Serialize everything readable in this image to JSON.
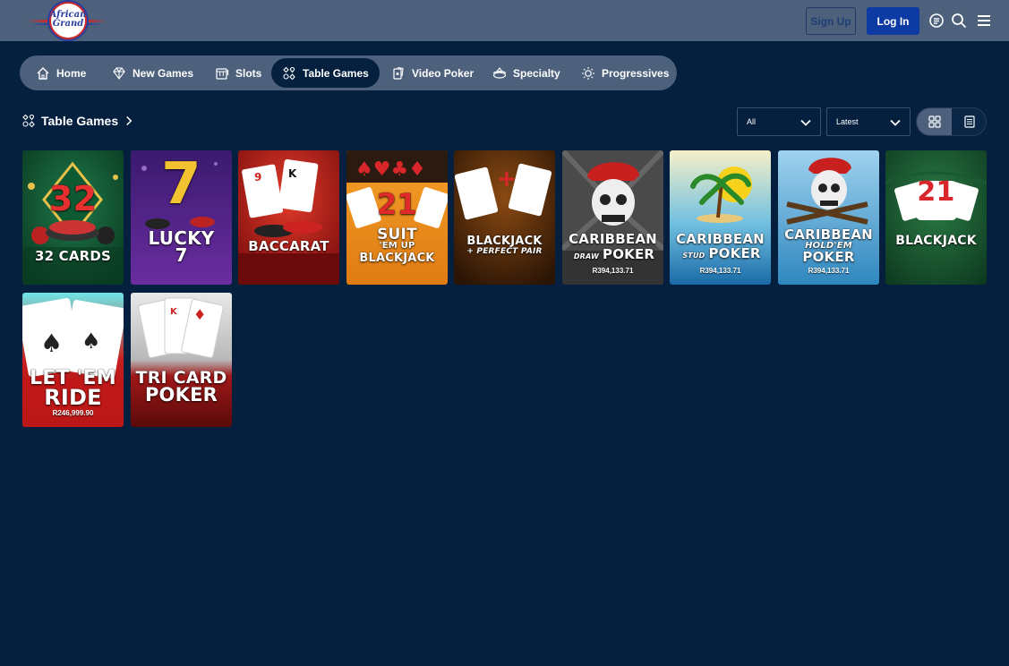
{
  "header": {
    "logo_line1": "African",
    "logo_line2": "Grand",
    "signup_label": "Sign Up",
    "login_label": "Log In",
    "icons": [
      "chat-icon",
      "search-icon",
      "menu-icon"
    ]
  },
  "nav": {
    "items": [
      {
        "label": "Home",
        "icon": "home-icon"
      },
      {
        "label": "New Games",
        "icon": "diamond-icon"
      },
      {
        "label": "Slots",
        "icon": "slot-machine-icon"
      },
      {
        "label": "Table Games",
        "icon": "table-games-icon",
        "active": true
      },
      {
        "label": "Video Poker",
        "icon": "video-poker-icon"
      },
      {
        "label": "Specialty",
        "icon": "specialty-icon"
      },
      {
        "label": "Progressives",
        "icon": "progressives-icon"
      }
    ]
  },
  "section": {
    "title": "Table Games",
    "filter_value": "All",
    "sort_value": "Latest"
  },
  "games": [
    {
      "line1": "32",
      "line2": "32 CARDS",
      "jackpot": ""
    },
    {
      "line1": "7",
      "line2": "LUCKY",
      "line3": "7",
      "jackpot": ""
    },
    {
      "line1": "BACCARAT",
      "jackpot": ""
    },
    {
      "line1": "21",
      "line2": "SUIT",
      "line3": "'EM UP",
      "line4": "BLACKJACK",
      "jackpot": ""
    },
    {
      "line1": "BLACKJACK",
      "line2": "+ PERFECT PAIR",
      "jackpot": ""
    },
    {
      "line1": "CARIBBEAN",
      "line2": "DRAW",
      "line3": "POKER",
      "jackpot": "R394,133.71"
    },
    {
      "line1": "CARIBBEAN",
      "line2": "STUD",
      "line3": "POKER",
      "jackpot": "R394,133.71"
    },
    {
      "line1": "CARIBBEAN",
      "line2": "HOLD'EM",
      "line3": "POKER",
      "jackpot": "R394,133.71"
    },
    {
      "line1": "21",
      "line2": "BLACKJACK",
      "jackpot": ""
    },
    {
      "line1": "LET 'EM",
      "line2": "RIDE",
      "jackpot": "R246,999.90"
    },
    {
      "line1": "TRI CARD",
      "line2": "POKER",
      "jackpot": ""
    }
  ],
  "colors": {
    "background": "#05203f",
    "header": "#4d617d",
    "login_button": "#0d3aa3"
  }
}
